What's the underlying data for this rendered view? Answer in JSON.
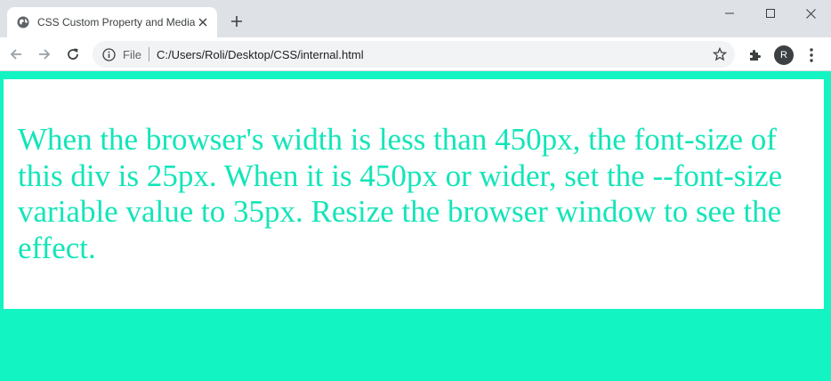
{
  "browser": {
    "tab_title": "CSS Custom Property and Media",
    "new_tab_label": "+",
    "scheme_label": "File",
    "url": "C:/Users/Roli/Desktop/CSS/internal.html",
    "avatar_initial": "R"
  },
  "page": {
    "text": "When the browser's width is less than 450px, the font-size of this div is 25px. When it is 450px or wider, set the --font-size variable value to 35px. Resize the browser window to see the effect."
  },
  "colors": {
    "page_background": "#13f4c3",
    "text_color": "#13e5b8",
    "box_background": "#ffffff"
  },
  "icons": [
    "globe-icon",
    "close-icon",
    "minimize-icon",
    "maximize-icon",
    "back-icon",
    "forward-icon",
    "reload-icon",
    "info-icon",
    "star-icon",
    "puzzle-icon",
    "kebab-menu-icon"
  ]
}
